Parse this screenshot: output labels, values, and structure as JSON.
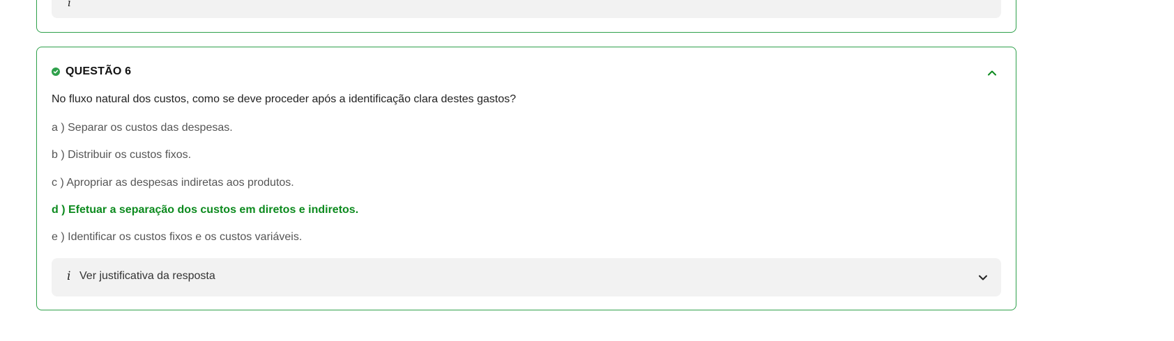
{
  "previous_question": {
    "justification_icon": "info-icon"
  },
  "question": {
    "status_icon": "check-circle-icon",
    "title": "QUESTÃO 6",
    "text": "No fluxo natural dos custos, como se deve proceder após a identificação clara destes gastos?",
    "options": [
      {
        "label": "a ) Separar os custos das despesas.",
        "correct": false
      },
      {
        "label": "b ) Distribuir os custos fixos.",
        "correct": false
      },
      {
        "label": "c ) Apropriar as despesas indiretas aos produtos.",
        "correct": false
      },
      {
        "label": "d ) Efetuar a separação dos custos em diretos e indiretos.",
        "correct": true
      },
      {
        "label": "e ) Identificar os custos fixos e os custos variáveis.",
        "correct": false
      }
    ],
    "collapse_icon": "chevron-up-icon",
    "justification": {
      "icon": "info-icon",
      "label": "Ver justificativa da resposta",
      "expand_icon": "chevron-down-icon"
    }
  },
  "colors": {
    "border": "#2ea04a",
    "correct": "#0c8a1e",
    "panel_bg": "#f2f2f2"
  }
}
